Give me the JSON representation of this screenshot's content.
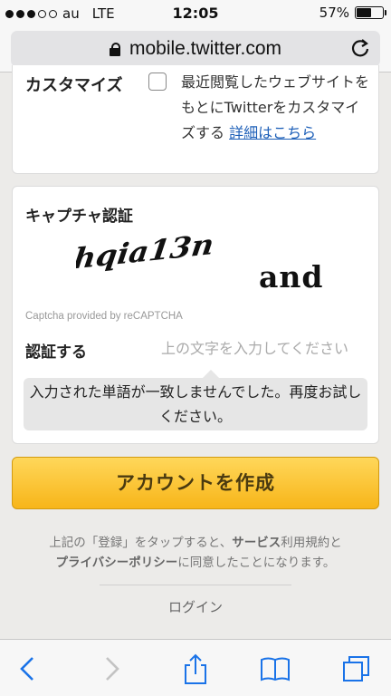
{
  "status_bar": {
    "carrier": "au",
    "network": "LTE",
    "time": "12:05",
    "battery": "57%",
    "battery_level": 0.57
  },
  "browser": {
    "url": "mobile.twitter.com",
    "lock_icon": "lock-icon",
    "reload_icon": "reload-icon"
  },
  "customize": {
    "label": "カスタマイズ",
    "description": "最近閲覧したウェブサイトをもとにTwitterをカスタマイズする",
    "details_link": "詳細はこちら",
    "checked": false
  },
  "captcha": {
    "title": "キャプチャ認証",
    "word1": "hqia13n",
    "word2": "and",
    "provided_by": "Captcha provided by reCAPTCHA",
    "input_label": "認証する",
    "input_placeholder": "上の文字を入力してください",
    "input_value": "",
    "error_message": "入力された単語が一致しませんでした。再度お試しください。"
  },
  "create_button": {
    "label": "アカウントを作成",
    "color": "#f7b519"
  },
  "terms": {
    "prefix": "上記の「登録」をタップすると、",
    "services": "サービス",
    "middle": "利用規約と",
    "privacy": "プライバシーポリシー",
    "suffix": "に同意したことになります。"
  },
  "login_link": "ログイン",
  "toolbar": {
    "icons": [
      "back-icon",
      "forward-icon",
      "share-icon",
      "bookmarks-icon",
      "tabs-icon"
    ]
  },
  "colors": {
    "accent_blue": "#1a73e8",
    "link": "#1d5fb8"
  }
}
